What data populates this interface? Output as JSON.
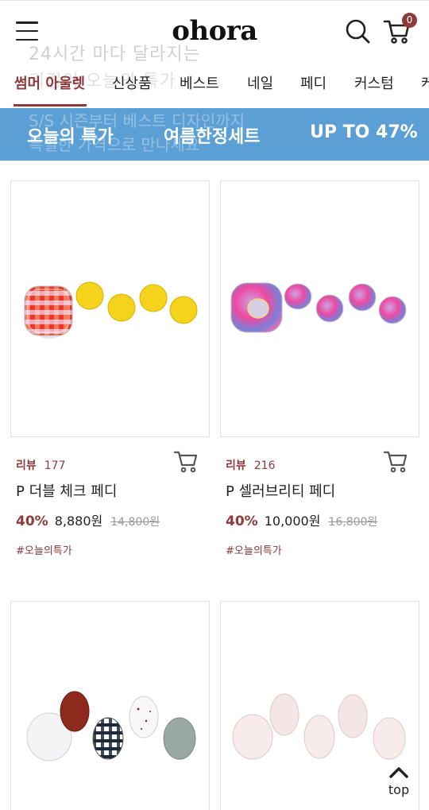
{
  "header": {
    "logo": "ohora",
    "cart_count": "0"
  },
  "overlay_text": {
    "line1": "24시간 마다 달라지는",
    "line2": "키링이 오늘의 특가",
    "line3": "S/S 시즌부터 베스트 디자인까지",
    "line4": "특별한 가격으로 만나세요"
  },
  "nav": {
    "items": [
      "썸머 아울렛",
      "신상품",
      "베스트",
      "네일",
      "페디",
      "커스텀",
      "케"
    ]
  },
  "banner": {
    "left": "오늘의 특가",
    "middle": "여름한정세트",
    "right": "UP TO 47%"
  },
  "products": [
    {
      "review_label": "리뷰",
      "review_count": "177",
      "name": "P 더블 체크 페디",
      "discount": "40%",
      "price": "8,880원",
      "original": "14,800원",
      "tag": "#오늘의특가"
    },
    {
      "review_label": "리뷰",
      "review_count": "216",
      "name": "P 셀러브리티 페디",
      "discount": "40%",
      "price": "10,000원",
      "original": "16,800원",
      "tag": "#오늘의특가"
    },
    {},
    {}
  ],
  "scroll_top": {
    "label": "top"
  },
  "icons": {
    "menu": "hamburger-menu-icon",
    "search": "search-icon",
    "cart": "cart-icon",
    "add_to_cart": "add-to-cart-icon",
    "top": "chevron-up-icon"
  },
  "colors": {
    "accent": "#8c3a3a",
    "banner": "#5b9fd5"
  }
}
